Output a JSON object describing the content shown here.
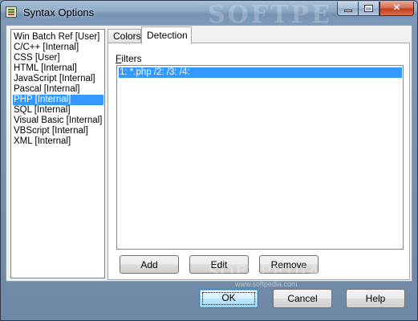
{
  "window": {
    "title": "Syntax Options",
    "watermark": "SOFTPE"
  },
  "syntax_list": {
    "items": [
      {
        "label": "Win Batch Ref [User]",
        "selected": false
      },
      {
        "label": "C/C++ [Internal]",
        "selected": false
      },
      {
        "label": "CSS [User]",
        "selected": false
      },
      {
        "label": "HTML [Internal]",
        "selected": false
      },
      {
        "label": "JavaScript [Internal]",
        "selected": false
      },
      {
        "label": "Pascal [Internal]",
        "selected": false
      },
      {
        "label": "PHP [Internal]",
        "selected": true
      },
      {
        "label": "SQL [Internal]",
        "selected": false
      },
      {
        "label": "Visual Basic [Internal]",
        "selected": false
      },
      {
        "label": "VBScript [Internal]",
        "selected": false
      },
      {
        "label": "XML [Internal]",
        "selected": false
      }
    ]
  },
  "tabs": [
    {
      "label": "Colors",
      "active": false
    },
    {
      "label": "Detection",
      "active": true
    }
  ],
  "detection": {
    "filters_label_first": "F",
    "filters_label_rest": "ilters",
    "filters": [
      "1: *.php /2:  /3:  /4:"
    ],
    "add_label": "Add",
    "edit_label": "Edit",
    "remove_label": "Remove"
  },
  "footer": {
    "watermark": "SOFTPEDIA",
    "watermark_url": "www.softpedia.com",
    "ok_label": "OK",
    "cancel_label": "Cancel",
    "help_label": "Help"
  },
  "colors": {
    "selection": "#3399ff",
    "window_frame": "#7f98b4"
  }
}
